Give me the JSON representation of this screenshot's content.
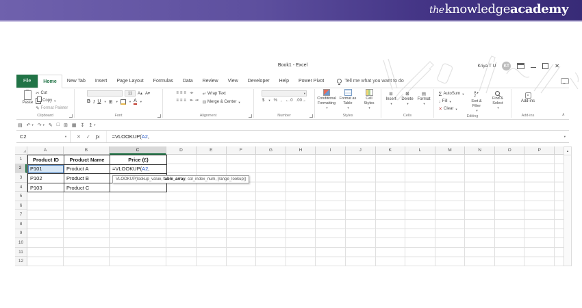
{
  "banner": {
    "logo_the": "the",
    "logo_knowledge": "knowledge",
    "logo_academy": "academy"
  },
  "titlebar": {
    "title": "Book1 - Excel",
    "user_name": "Kriya T U",
    "user_initials": "KT"
  },
  "tabs": {
    "file": "File",
    "home": "Home",
    "new_tab": "New Tab",
    "insert": "Insert",
    "page_layout": "Page Layout",
    "formulas": "Formulas",
    "data": "Data",
    "review": "Review",
    "view": "View",
    "developer": "Developer",
    "help": "Help",
    "power_pivot": "Power Pivot",
    "tell_me": "Tell me what you want to do"
  },
  "ribbon": {
    "clipboard": {
      "label": "Clipboard",
      "paste": "Paste",
      "cut": "Cut",
      "copy": "Copy",
      "format_painter": "Format Painter"
    },
    "font": {
      "label": "Font",
      "size": "11",
      "bold": "B",
      "italic": "I",
      "underline": "U"
    },
    "alignment": {
      "label": "Alignment",
      "wrap_text": "Wrap Text",
      "merge_center": "Merge & Center"
    },
    "number": {
      "label": "Number"
    },
    "styles": {
      "label": "Styles",
      "conditional_1": "Conditional",
      "conditional_2": "Formatting",
      "format_table_1": "Format as",
      "format_table_2": "Table",
      "cell_styles_1": "Cell",
      "cell_styles_2": "Styles"
    },
    "cells": {
      "label": "Cells",
      "insert": "Insert",
      "delete": "Delete",
      "format": "Format"
    },
    "editing": {
      "label": "Editing",
      "autosum": "AutoSum",
      "fill": "Fill",
      "clear": "Clear",
      "sort_1": "Sort &",
      "sort_2": "Filter",
      "find_1": "Find &",
      "find_2": "Select"
    },
    "addins": {
      "label": "Add-ins",
      "button": "Add-ins"
    }
  },
  "icons": {
    "dropdown": "▾",
    "save": "▤",
    "undo": "↶",
    "redo": "↷",
    "painter": "✎",
    "new_doc": "□",
    "grid": "⊞",
    "paint": "▦",
    "sort_down": "↧",
    "sort_up": "↥",
    "cut": "✂",
    "grow_font": "A▴",
    "shrink_font": "A▾",
    "borders": "⊞",
    "align_top": "≡",
    "align_mid": "≡",
    "align_bot": "≡",
    "orient": "⌯",
    "align_l": "≡",
    "align_c": "≡",
    "align_r": "≡",
    "indent_l": "⇤",
    "indent_r": "⇥",
    "wrap": "↵",
    "merge": "⊟",
    "currency": "$",
    "percent": "%",
    "comma": ",",
    "inc_dec": "←.0",
    "dec_dec": ".00→",
    "sigma": "Σ",
    "fill_down": "↓",
    "clear_x": "✕",
    "az_a": "A",
    "az_z": "Z",
    "funnel": "▼",
    "insert_cells": "⊞",
    "delete_cells": "⊠",
    "format_cells": "▤",
    "cancel": "✕",
    "enter": "✓",
    "fx": "fx",
    "select_all": "◢",
    "scroll_up": "▴",
    "collapse": "∧",
    "win_close": "✕"
  },
  "formula_bar": {
    "name_box": "C2"
  },
  "formula": {
    "pre": "=VLOOKUP(",
    "ref": "A2",
    "tail": ","
  },
  "sheet": {
    "columns": [
      "A",
      "B",
      "C",
      "D",
      "E",
      "F",
      "G",
      "H",
      "I",
      "J",
      "K",
      "L",
      "M",
      "N",
      "O",
      "P"
    ],
    "rows": [
      "1",
      "2",
      "3",
      "4",
      "5",
      "6",
      "7",
      "8",
      "9",
      "10",
      "11",
      "12"
    ],
    "cells": {
      "a1": "Product ID",
      "b1": "Product Name",
      "c1": "Price (£)",
      "a2": "P101",
      "b2": "Product A",
      "a3": "P102",
      "b3": "Product B",
      "a4": "P103",
      "b4": "Product C"
    },
    "tooltip": {
      "pre": "VLOOKUP(lookup_value, ",
      "bold": "table_array",
      "post": ", col_index_num, [range_lookup])"
    }
  },
  "colors": {
    "accent_green": "#217346",
    "banner_left": "#6f61ad",
    "banner_right": "#382b77",
    "ref_blue": "#2456c4",
    "ref_fill": "#d7e7f6"
  }
}
